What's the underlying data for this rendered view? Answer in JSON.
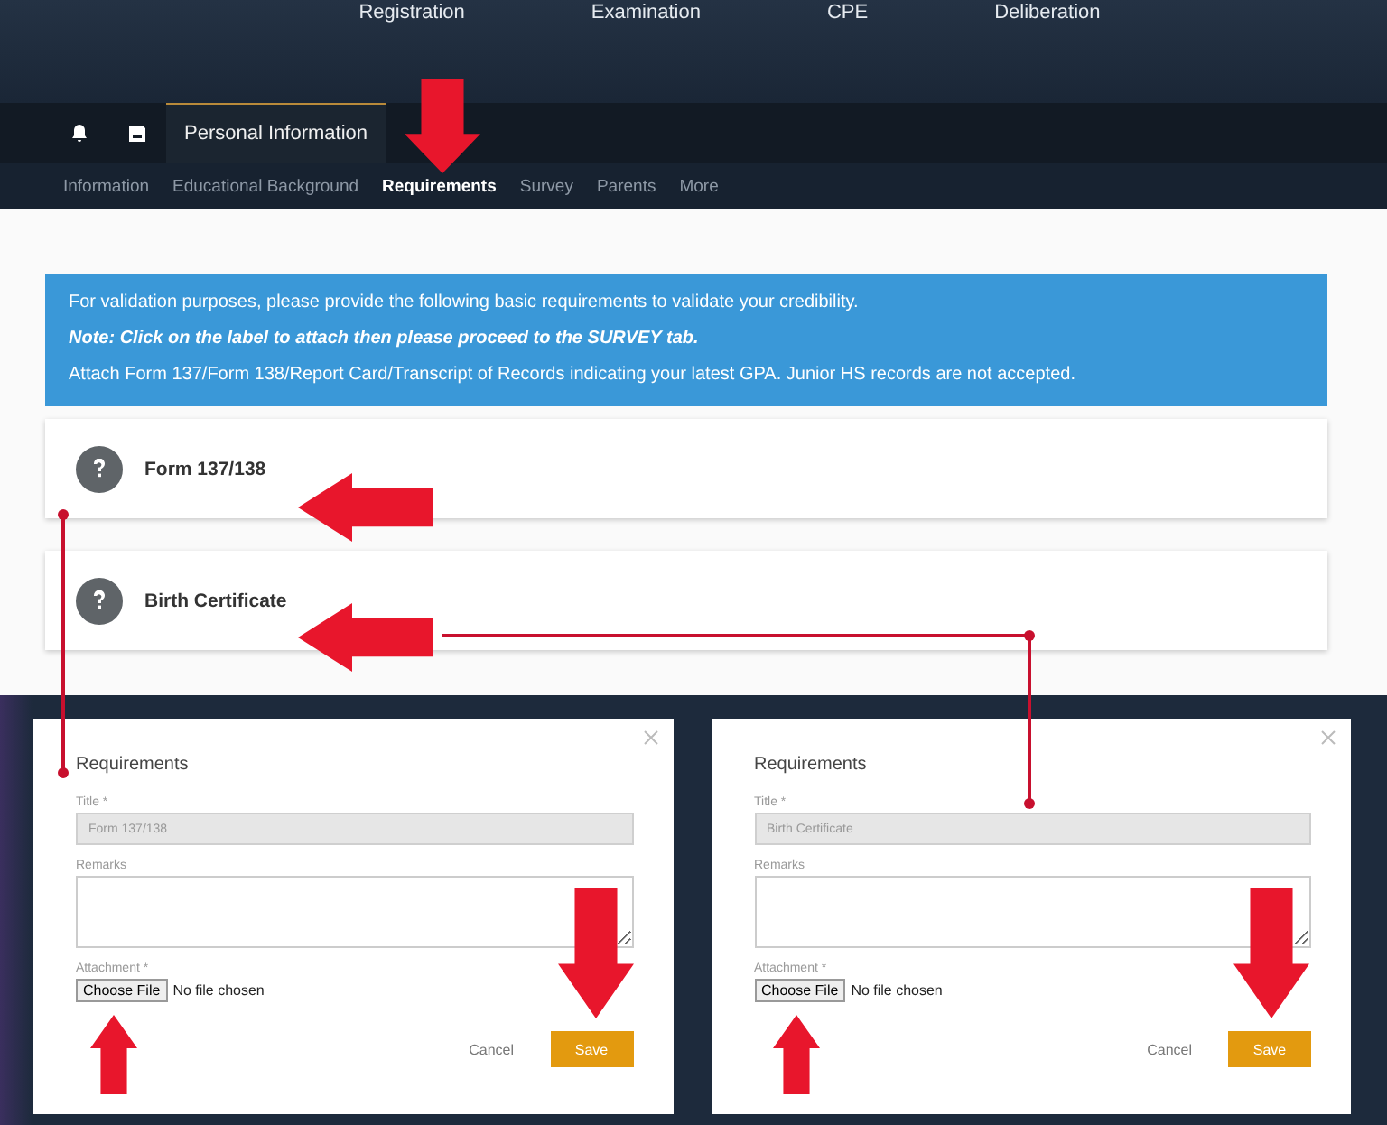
{
  "top_nav": [
    {
      "label": "Registration"
    },
    {
      "label": "Examination"
    },
    {
      "label": "CPE"
    },
    {
      "label": "Deliberation"
    }
  ],
  "tabs": [
    {
      "label": "Personal Information",
      "selected": true
    }
  ],
  "sub_nav": [
    {
      "label": "Information",
      "selected": false
    },
    {
      "label": "Educational Background",
      "selected": false
    },
    {
      "label": "Requirements",
      "selected": true
    },
    {
      "label": "Survey",
      "selected": false
    },
    {
      "label": "Parents",
      "selected": false
    },
    {
      "label": "More",
      "selected": false
    }
  ],
  "notice": [
    {
      "kind": "plain",
      "text": "For validation purposes, please provide the following basic requirements to validate your credibility."
    },
    {
      "kind": "note",
      "text": "Note: Click on the label to attach then please proceed to the SURVEY tab."
    },
    {
      "kind": "plain",
      "text": "Attach Form 137/Form 138/Report Card/Transcript of Records indicating your latest GPA. Junior HS records are not accepted."
    }
  ],
  "requirements": [
    {
      "label": "Form 137/138"
    },
    {
      "label": "Birth Certificate"
    }
  ],
  "dialogs": [
    {
      "title": "Requirements",
      "title_label": "Title *",
      "title_value": "Form 137/138",
      "remarks_label": "Remarks",
      "attachment_label": "Attachment *",
      "file_button": "Choose File",
      "file_status": "No file chosen",
      "cancel": "Cancel",
      "save": "Save"
    },
    {
      "title": "Requirements",
      "title_label": "Title *",
      "title_value": "Birth Certificate",
      "remarks_label": "Remarks",
      "attachment_label": "Attachment *",
      "file_button": "Choose File",
      "file_status": "No file chosen",
      "cancel": "Cancel",
      "save": "Save"
    }
  ]
}
